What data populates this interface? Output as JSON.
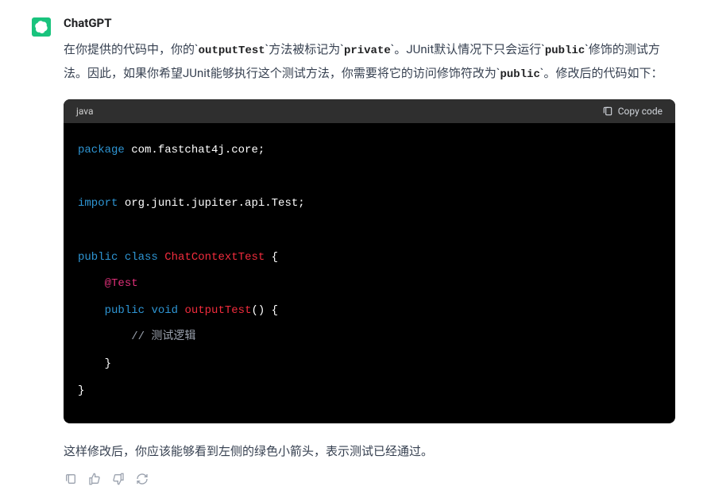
{
  "author": "ChatGPT",
  "paragraph": {
    "parts": [
      {
        "t": "在你提供的代码中，你的`"
      },
      {
        "c": "outputTest"
      },
      {
        "t": "`方法被标记为`"
      },
      {
        "c": "private"
      },
      {
        "t": "`。JUnit默认情况下只会运行`"
      },
      {
        "c": "public"
      },
      {
        "t": "`修饰的测试方法。因此，如果你希望JUnit能够执行这个测试方法，你需要将它的访问修饰符改为`"
      },
      {
        "c": "public"
      },
      {
        "t": "`。修改后的代码如下："
      }
    ]
  },
  "codeblock": {
    "lang": "java",
    "copy_label": "Copy code",
    "lines": [
      [
        {
          "cls": "kw",
          "t": "package"
        },
        {
          "cls": "pkg",
          "t": " com.fastchat4j.core;"
        }
      ],
      [],
      [
        {
          "cls": "kw",
          "t": "import"
        },
        {
          "cls": "pkg",
          "t": " org.junit.jupiter.api.Test;"
        }
      ],
      [],
      [
        {
          "cls": "kw",
          "t": "public"
        },
        {
          "cls": "pkg",
          "t": " "
        },
        {
          "cls": "kw",
          "t": "class"
        },
        {
          "cls": "pkg",
          "t": " "
        },
        {
          "cls": "cls",
          "t": "ChatContextTest"
        },
        {
          "cls": "pkg",
          "t": " {"
        }
      ],
      [
        {
          "cls": "pkg",
          "t": "    "
        },
        {
          "cls": "ann",
          "t": "@Test"
        }
      ],
      [
        {
          "cls": "pkg",
          "t": "    "
        },
        {
          "cls": "kw",
          "t": "public"
        },
        {
          "cls": "pkg",
          "t": " "
        },
        {
          "cls": "kw",
          "t": "void"
        },
        {
          "cls": "pkg",
          "t": " "
        },
        {
          "cls": "fn",
          "t": "outputTest"
        },
        {
          "cls": "pkg",
          "t": "() {"
        }
      ],
      [
        {
          "cls": "pkg",
          "t": "        "
        },
        {
          "cls": "cmt",
          "t": "// 测试逻辑"
        }
      ],
      [
        {
          "cls": "pkg",
          "t": "    }"
        }
      ],
      [
        {
          "cls": "pkg",
          "t": "}"
        }
      ]
    ]
  },
  "footer_text": "这样修改后，你应该能够看到左侧的绿色小箭头，表示测试已经通过。",
  "icons": {
    "copy": "copy-icon",
    "thumbs_up": "thumbs-up-icon",
    "thumbs_down": "thumbs-down-icon",
    "regenerate": "regenerate-icon",
    "clipboard": "clipboard-icon"
  }
}
